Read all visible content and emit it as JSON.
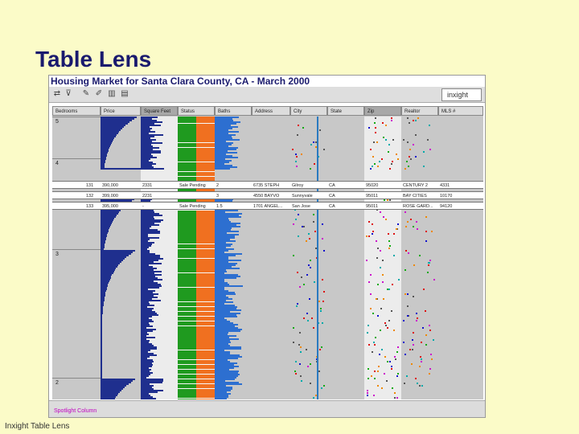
{
  "slide": {
    "title": "Table Lens",
    "footer": "Inxight Table Lens"
  },
  "app": {
    "title": "Housing Market for Santa Clara County, CA - March 2000",
    "brand": "inxight",
    "columns": [
      "Bedrooms",
      "Price",
      "Square Feet",
      "Status",
      "Baths",
      "Address",
      "City",
      "State",
      "Zip",
      "Realtor",
      "MLS #"
    ],
    "selected_columns": [
      "Square Feet",
      "Zip"
    ],
    "group_labels": [
      "5",
      "4",
      "3",
      "2"
    ],
    "focus_rows": [
      {
        "row": "131",
        "cells": [
          "",
          "390,000",
          "2331",
          "Sale Pending",
          "2",
          "6735 STEPH",
          "Gilroy",
          "CA",
          "95020",
          "CENTURY 2",
          "4331"
        ]
      },
      {
        "row": "132",
        "cells": [
          "",
          "399,000",
          "2231",
          "",
          "3",
          "4550 BAYVO",
          "Sunnyvale",
          "CA",
          "95011",
          "BAY CITIES",
          "10170"
        ]
      },
      {
        "row": "133",
        "cells": [
          "",
          "395,000",
          "-",
          "Sale Pending",
          "1.5",
          "1701 ANGEL...",
          "San Jose",
          "CA",
          "95011",
          "ROSE GARD...",
          "94120"
        ]
      }
    ],
    "spotlight_label": "Spotlight Column"
  }
}
